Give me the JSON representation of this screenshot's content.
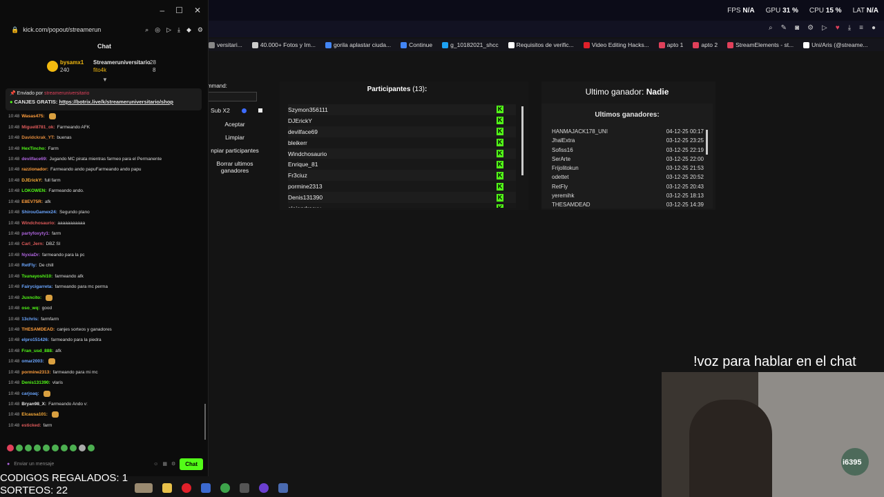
{
  "perf": {
    "fps_label": "FPS",
    "fps": "N/A",
    "gpu_label": "GPU",
    "gpu": "31 %",
    "cpu_label": "CPU",
    "cpu": "15 %",
    "lat_label": "LAT",
    "lat": "N/A"
  },
  "popout": {
    "url": "kick.com/popout/streamerun",
    "chat_title": "Chat",
    "pinned": {
      "user1": "bysamx1",
      "n1": "240",
      "user2": "Streameruniversitario",
      "n2": "28",
      "user3": "fito4k",
      "n3": "8"
    },
    "announce_label": "Enviado por",
    "announce_user": "streameruniversitario",
    "announce_text": "CANJES GRATIS:",
    "announce_link": "https://botrix.live/k/streameruniversitario/shop",
    "input_placeholder": "Enviar un mensaje",
    "chat_button": "Chat",
    "messages": [
      {
        "time": "10:48",
        "user": "Wasas475:",
        "text": "",
        "color": "#ff9e3d"
      },
      {
        "time": "10:48",
        "user": "Miguel8781_ok:",
        "text": "Farmeando AFK",
        "color": "#e05b5b"
      },
      {
        "time": "10:48",
        "user": "Davidckrak_YT:",
        "text": "buenas",
        "color": "#e08a3c"
      },
      {
        "time": "10:48",
        "user": "HexTincho:",
        "text": "Farm",
        "color": "#53fc18"
      },
      {
        "time": "10:48",
        "user": "devilface69:",
        "text": "Jugando MC pirata mientras farmeo para el Permanente",
        "color": "#b065e0"
      },
      {
        "time": "10:48",
        "user": "razzionador:",
        "text": "Farmeando ando papuFarmeando ando papu",
        "color": "#ff9e3d"
      },
      {
        "time": "10:48",
        "user": "DJErickY:",
        "text": "full farm",
        "color": "#ffb03a"
      },
      {
        "time": "10:48",
        "user": "LOKOWEN:",
        "text": "Farmeando ando.",
        "color": "#53fc18"
      },
      {
        "time": "10:48",
        "user": "E8EV75R:",
        "text": "afk",
        "color": "#ff9e3d"
      },
      {
        "time": "10:48",
        "user": "ShirouGamex24:",
        "text": "Segundo plano",
        "color": "#6ba6ff"
      },
      {
        "time": "10:48",
        "user": "Windchosaurio:",
        "text": "aaaaaaaaaaa",
        "color": "#e05b5b"
      },
      {
        "time": "10:48",
        "user": "partyfoxyty1:",
        "text": "farm",
        "color": "#b065e0"
      },
      {
        "time": "10:48",
        "user": "Carl_Jern:",
        "text": "DBZ SI",
        "color": "#e05b5b"
      },
      {
        "time": "10:48",
        "user": "NyxiaDr:",
        "text": "farmeando para la pc",
        "color": "#b065e0"
      },
      {
        "time": "10:48",
        "user": "RetFly:",
        "text": "De chill",
        "color": "#6ba6ff"
      },
      {
        "time": "10:48",
        "user": "Tsunayoshi10:",
        "text": "farmeando afk",
        "color": "#53fc18"
      },
      {
        "time": "10:48",
        "user": "Fairycigarreta:",
        "text": "farmeando para mc perma",
        "color": "#6ba6ff"
      },
      {
        "time": "10:48",
        "user": "Juxncito:",
        "text": "",
        "color": "#53fc18"
      },
      {
        "time": "10:48",
        "user": "oso_wq:",
        "text": "good",
        "color": "#53fc18"
      },
      {
        "time": "10:48",
        "user": "13chris:",
        "text": "farmfarm",
        "color": "#6ba6ff"
      },
      {
        "time": "10:48",
        "user": "THESAMDEAD:",
        "text": "canjes sorteos y ganadores",
        "color": "#ff9e3d"
      },
      {
        "time": "10:48",
        "user": "elpro151426:",
        "text": "farmeando para la piedra",
        "color": "#6ba6ff"
      },
      {
        "time": "10:48",
        "user": "Fran_usd_888:",
        "text": "afk",
        "color": "#53fc18"
      },
      {
        "time": "10:48",
        "user": "omar2003:",
        "text": "",
        "color": "#6ba6ff"
      },
      {
        "time": "10:48",
        "user": "pormine2313:",
        "text": "farmeando para mi mc",
        "color": "#ff9e3d"
      },
      {
        "time": "10:48",
        "user": "Denis131390:",
        "text": "vlaris",
        "color": "#53fc18"
      },
      {
        "time": "10:48",
        "user": "carjoaq:",
        "text": "",
        "color": "#6ba6ff"
      },
      {
        "time": "10:48",
        "user": "Bryan98_X:",
        "text": "Farmeando Ando v:",
        "color": "#e6e6e6"
      },
      {
        "time": "10:48",
        "user": "Elcausa101:",
        "text": "",
        "color": "#ffb03a"
      },
      {
        "time": "10:48",
        "user": "esticked:",
        "text": "farm",
        "color": "#e05b5b"
      }
    ]
  },
  "bookmarks": [
    "versitari...",
    "40.000+ Fotos y Im...",
    "gorila aplastar ciuda...",
    "Continue",
    "g_10182021_shcc",
    "Requisitos de verific...",
    "Video Editing Hacks...",
    "apto 1",
    "apto 2",
    "StreamElements - st...",
    "Uni/Aris (@streame..."
  ],
  "giveaway": {
    "command_label": "mmand:",
    "sub_label": "Sub X2",
    "accept": "Aceptar",
    "clean": "Limpiar",
    "clean_participants": "npiar participantes",
    "clear_winners": "Borrar ultimos ganadores",
    "participants_title": "Participantes",
    "participants_count": "(13)",
    "participants_colon": ":",
    "participants": [
      "Szymon356111",
      "DJErickY",
      "devilface69",
      "bleikerr",
      "Windchosaurio",
      "Enrique_81",
      "Fr3ciuz",
      "pormine2313",
      "Denis131390",
      "alejandrosxy"
    ],
    "last_winner_label": "Ultimo ganador:",
    "last_winner": "Nadie",
    "winners_title": "Ultimos ganadores:",
    "winners": [
      {
        "name": "HANMAJACK178_UNI",
        "date": "04-12-25 00:17"
      },
      {
        "name": "JhalExtra",
        "date": "03-12-25 23:25"
      },
      {
        "name": "Sofiss16",
        "date": "03-12-25 22:19"
      },
      {
        "name": "SerArte",
        "date": "03-12-25 22:00"
      },
      {
        "name": "Frijolitokun",
        "date": "03-12-25 21:53"
      },
      {
        "name": "odettet",
        "date": "03-12-25 20:52"
      },
      {
        "name": "RetFly",
        "date": "03-12-25 20:43"
      },
      {
        "name": "yeremihk",
        "date": "03-12-25 18:13"
      },
      {
        "name": "THESAMDEAD",
        "date": "03-12-25 14:39"
      }
    ]
  },
  "overlay": {
    "voz": "!voz para hablar en el chat",
    "codigos": "CODIGOS REGALADOS: 1",
    "sorteos": "SORTEOS: 22",
    "cam_badge": "i6395"
  }
}
